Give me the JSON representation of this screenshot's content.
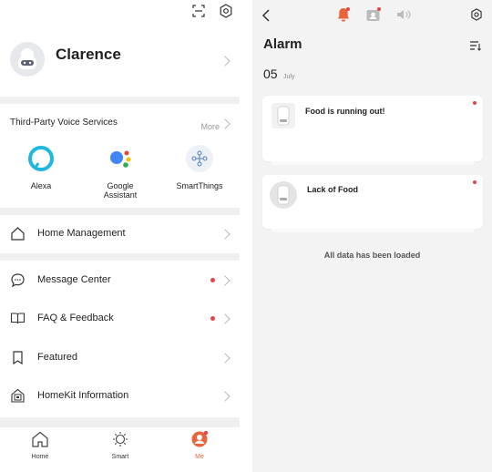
{
  "profile": {
    "name": "Clarence"
  },
  "voice_services": {
    "title": "Third-Party Voice Services",
    "more_label": "More",
    "items": [
      {
        "name": "Alexa",
        "icon": "alexa-icon"
      },
      {
        "name": "Google\nAssistant",
        "icon": "google-assistant-icon"
      },
      {
        "name": "SmartThings",
        "icon": "smartthings-icon"
      }
    ]
  },
  "menu": {
    "home_management": "Home Management",
    "message_center": "Message Center",
    "faq_feedback": "FAQ & Feedback",
    "featured": "Featured",
    "homekit": "HomeKit Information"
  },
  "tabbar": {
    "home": "Home",
    "smart": "Smart",
    "me": "Me"
  },
  "alarm": {
    "title": "Alarm",
    "date_day": "05",
    "date_month": "July",
    "cards": [
      {
        "title": "Food is running out!"
      },
      {
        "title": "Lack of Food"
      }
    ],
    "footer": "All data has been loaded"
  },
  "colors": {
    "accent": "#e8643c",
    "badge": "#e64545",
    "right_bg": "#f3f3f3"
  }
}
